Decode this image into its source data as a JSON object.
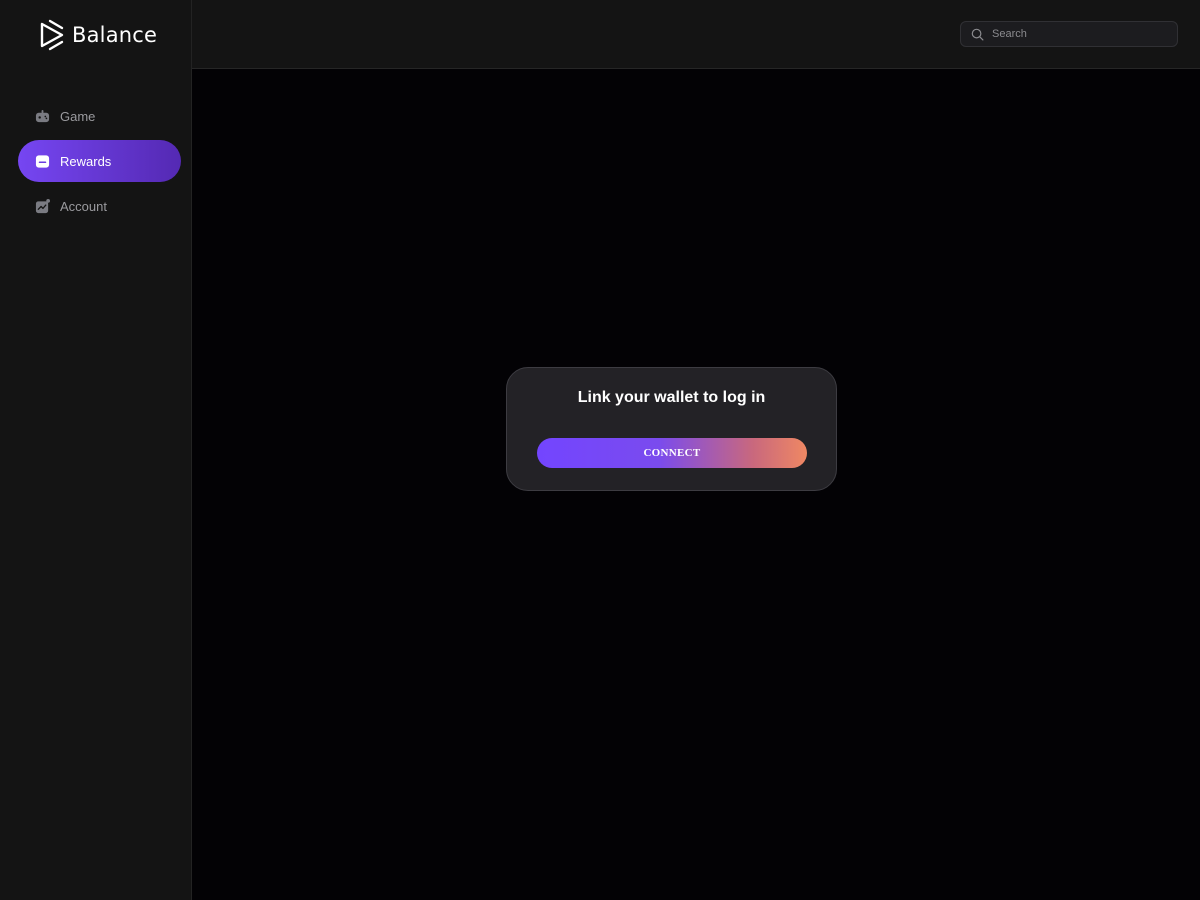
{
  "brand": {
    "name": "Balance"
  },
  "sidebar": {
    "items": [
      {
        "label": "Game",
        "icon": "gamepad-icon",
        "active": false
      },
      {
        "label": "Rewards",
        "icon": "wallet-icon",
        "active": true
      },
      {
        "label": "Account",
        "icon": "chart-icon",
        "active": false
      }
    ]
  },
  "header": {
    "search": {
      "placeholder": "Search",
      "value": ""
    }
  },
  "login_card": {
    "title": "Link your wallet to log in",
    "connect_label": "CONNECT"
  },
  "colors": {
    "accent": "#7646f2",
    "accent_end": "#ef8863",
    "sidebar_bg": "#141414",
    "main_bg": "#030205",
    "card_bg": "#232226"
  }
}
